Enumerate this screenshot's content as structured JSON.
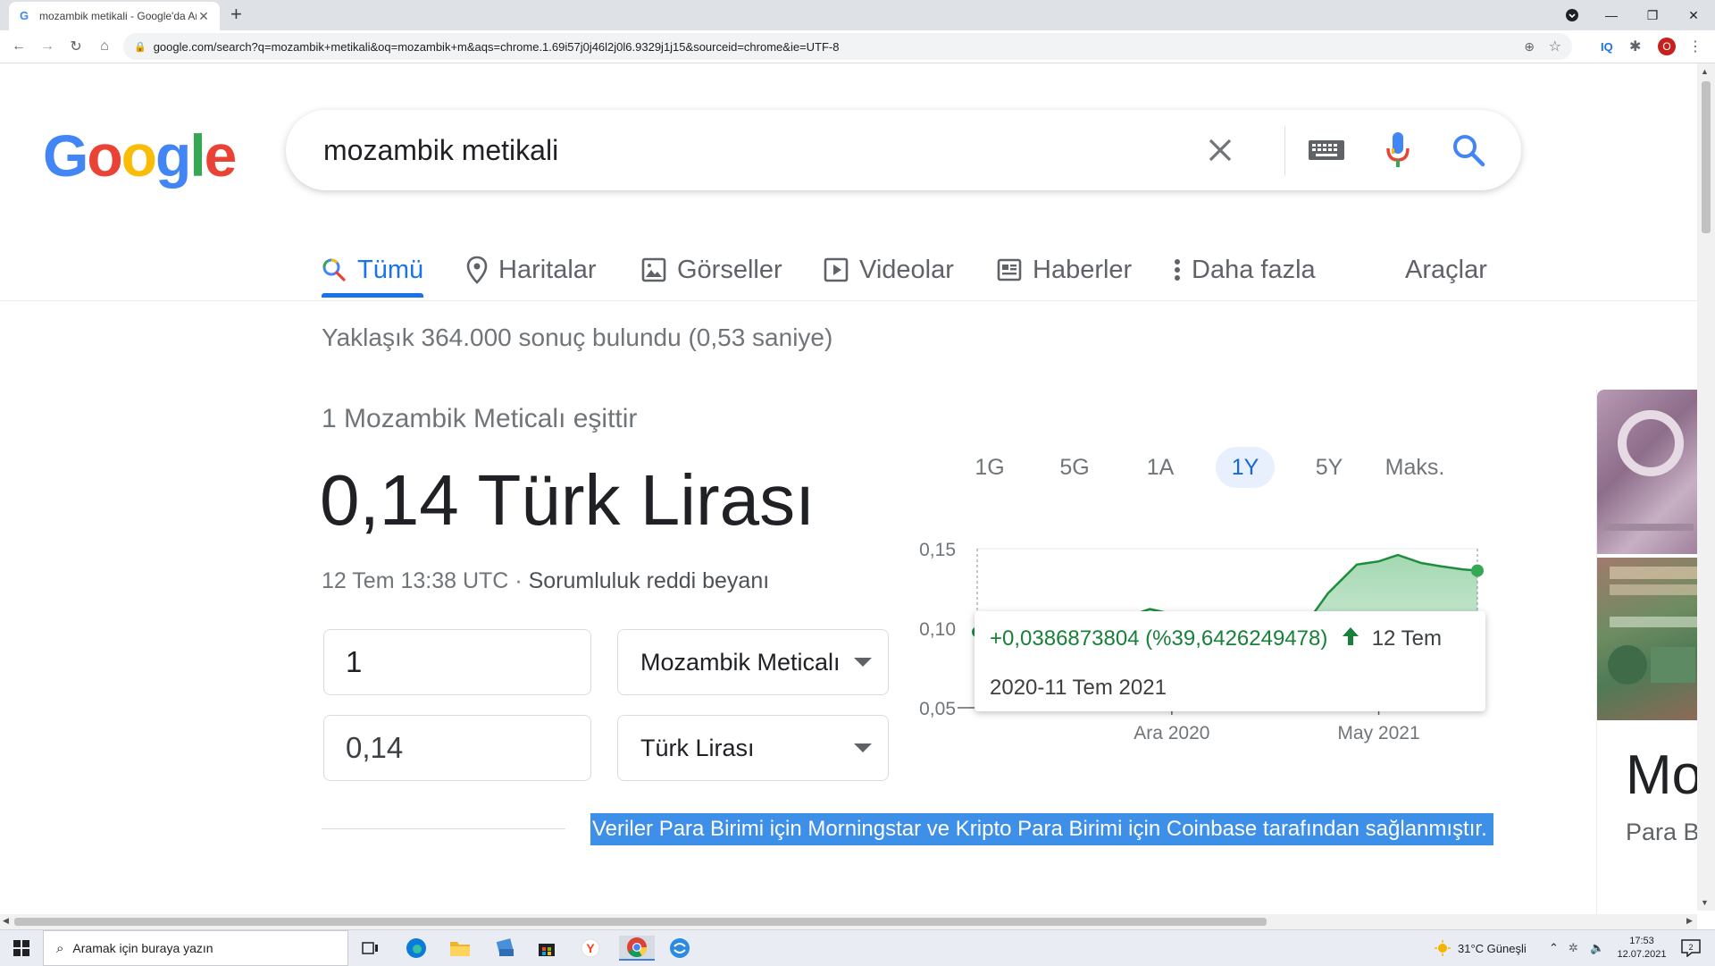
{
  "browser": {
    "tab_title": "mozambik metikali - Google'da Ara",
    "url": "google.com/search?q=mozambik+metikali&oq=mozambik+m&aqs=chrome.1.69i57j0j46l2j0l6.9329j1j15&sourceid=chrome&ie=UTF-8",
    "ext_iq": "IQ",
    "profile_initial": "O"
  },
  "search": {
    "query": "mozambik metikali"
  },
  "tabs": [
    {
      "label": "Tümü",
      "icon": "search-icon"
    },
    {
      "label": "Haritalar",
      "icon": "map-pin-icon"
    },
    {
      "label": "Görseller",
      "icon": "image-icon"
    },
    {
      "label": "Videolar",
      "icon": "video-icon"
    },
    {
      "label": "Haberler",
      "icon": "news-icon"
    },
    {
      "label": "Daha fazla",
      "icon": "more-vert-icon"
    }
  ],
  "tools_label": "Araçlar",
  "stats": "Yaklaşık 364.000 sonuç bulundu (0,53 saniye)",
  "converter": {
    "equals_label": "1 Mozambik Meticalı eşittir",
    "result": "0,14 Türk Lirası",
    "timestamp": "12 Tem 13:38 UTC",
    "separator": " · ",
    "disclaimer": "Sorumluluk reddi beyanı",
    "from_amount": "1",
    "from_currency": "Mozambik Meticalı",
    "to_amount": "0,14",
    "to_currency": "Türk Lirası",
    "attribution": "Veriler Para Birimi için Morningstar ve Kripto Para Birimi için Coinbase tarafından sağlanmıştır."
  },
  "ranges": [
    "1G",
    "5G",
    "1A",
    "1Y",
    "5Y",
    "Maks."
  ],
  "active_range": "1Y",
  "tooltip": {
    "change": "+0,0386873804 (%39,6426249478)",
    "end_label": "12 Tem",
    "period": "2020-11 Tem 2021"
  },
  "right_panel": {
    "title": "Mo",
    "subtitle": "Para B"
  },
  "taskbar": {
    "search_placeholder": "Aramak için buraya yazın",
    "weather": "31°C  Güneşli",
    "time": "17:53",
    "date": "12.07.2021",
    "notifications": "2"
  },
  "chart_data": {
    "type": "line",
    "y_ticks": [
      "0,15",
      "0,10",
      "0,05"
    ],
    "x_ticks": [
      "Ara 2020",
      "May 2021"
    ],
    "ylim": [
      0.05,
      0.15
    ],
    "color": "#1e8e3e",
    "x": [
      "2020-07-12",
      "2020-08-01",
      "2020-09-01",
      "2020-10-01",
      "2020-11-01",
      "2020-11-15",
      "2020-12-01",
      "2020-12-15",
      "2021-01-01",
      "2021-01-20",
      "2021-02-01",
      "2021-02-15",
      "2021-03-01",
      "2021-03-15",
      "2021-03-25",
      "2021-04-01",
      "2021-04-15",
      "2021-05-01",
      "2021-05-15",
      "2021-06-01",
      "2021-06-15",
      "2021-07-01",
      "2021-07-12"
    ],
    "y": [
      0.0976,
      0.099,
      0.101,
      0.104,
      0.108,
      0.112,
      0.109,
      0.106,
      0.103,
      0.101,
      0.104,
      0.106,
      0.108,
      0.11,
      0.122,
      0.128,
      0.14,
      0.142,
      0.146,
      0.141,
      0.139,
      0.137,
      0.1362
    ]
  }
}
